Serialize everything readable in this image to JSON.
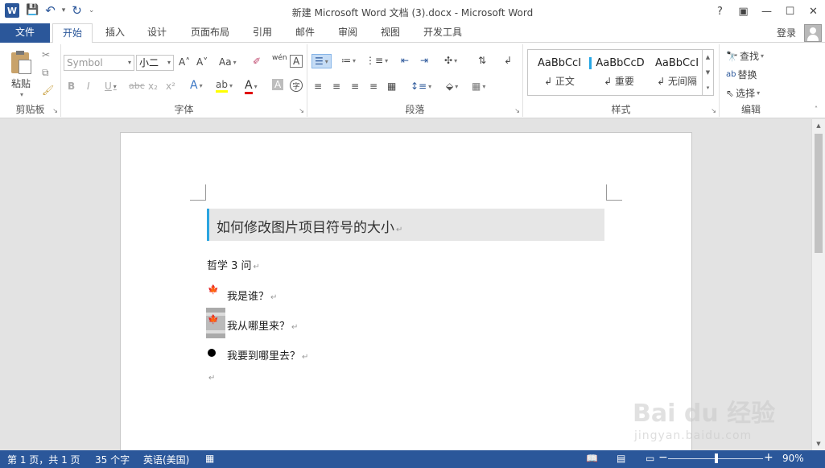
{
  "window": {
    "title": "新建 Microsoft Word 文档 (3).docx - Microsoft Word",
    "app_logo": "W",
    "controls": [
      "?",
      "▣",
      "—",
      "☐",
      "✕"
    ]
  },
  "qat": {
    "save": "💾",
    "undo": "↶",
    "redo": "↻",
    "customize": "⌄"
  },
  "tabs": {
    "file": "文件",
    "items": [
      "开始",
      "插入",
      "设计",
      "页面布局",
      "引用",
      "邮件",
      "审阅",
      "视图",
      "开发工具"
    ],
    "active": "开始",
    "signin": "登录"
  },
  "ribbon": {
    "clipboard": {
      "paste": "粘贴",
      "label": "剪贴板"
    },
    "font": {
      "font_name": "Symbol",
      "font_size": "小二",
      "label": "字体",
      "bold": "B",
      "italic": "I",
      "underline": "U",
      "strike": "abc",
      "sub": "x₂",
      "sup": "x²",
      "grow": "A˄",
      "shrink": "A˅",
      "case": "Aa",
      "phonetic": "wén",
      "charborder": "A"
    },
    "paragraph": {
      "label": "段落"
    },
    "styles": {
      "label": "样式",
      "items": [
        {
          "sample": "AaBbCcI",
          "name": "↲ 正文"
        },
        {
          "sample": "AaBbCcD",
          "name": "↲ 重要"
        },
        {
          "sample": "AaBbCcI",
          "name": "↲ 无间隔"
        }
      ]
    },
    "editing": {
      "label": "编辑",
      "find": "查找",
      "replace": "替换",
      "select": "选择"
    }
  },
  "document": {
    "heading": "如何修改图片项目符号的大小",
    "intro": "哲学 3 问",
    "bullets": [
      "我是谁？",
      "我从哪里来？",
      "我要到哪里去？"
    ],
    "para_mark": "↵"
  },
  "status": {
    "page": "第 1 页，共 1 页",
    "words": "35 个字",
    "language": "英语(美国)",
    "zoom": "90%",
    "zoom_minus": "−",
    "zoom_plus": "+"
  },
  "watermark": {
    "main": "Bai du 经验",
    "sub": "jingyan.baidu.com"
  },
  "colors": {
    "accent": "#2b579a",
    "heading_bar": "#2ca5e0",
    "leaf": "#b01818"
  }
}
